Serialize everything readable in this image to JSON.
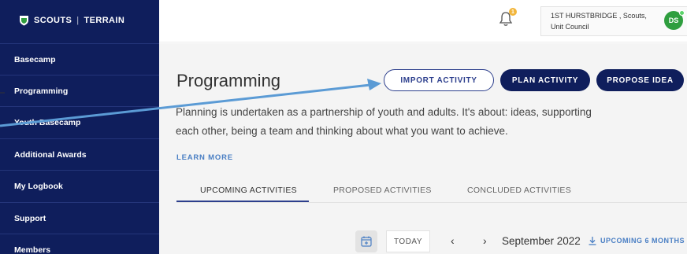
{
  "brand": {
    "name": "SCOUTS",
    "divider": "|",
    "product": "TERRAIN"
  },
  "sidebar": {
    "items": [
      {
        "label": "Basecamp"
      },
      {
        "label": "Programming"
      },
      {
        "label": "Youth Basecamp"
      },
      {
        "label": "Additional Awards"
      },
      {
        "label": "My Logbook"
      },
      {
        "label": "Support"
      },
      {
        "label": "Members"
      }
    ]
  },
  "header": {
    "notification_count": "1",
    "user_unit": "1ST HURSTBRIDGE , Scouts, Unit Council",
    "avatar_initials": "DS"
  },
  "main": {
    "title": "Programming",
    "buttons": {
      "import": "IMPORT ACTIVITY",
      "plan": "PLAN ACTIVITY",
      "propose": "PROPOSE IDEA"
    },
    "description": "Planning is undertaken as a partnership of youth and adults. It's about: ideas, supporting each other, being a team and thinking about what you want to achieve.",
    "learn_more": "LEARN MORE",
    "tabs": [
      {
        "label": "UPCOMING ACTIVITIES"
      },
      {
        "label": "PROPOSED ACTIVITIES"
      },
      {
        "label": "CONCLUDED ACTIVITIES"
      }
    ],
    "calendar": {
      "today": "TODAY",
      "month": "September 2022",
      "upcoming": "UPCOMING 6 MONTHS"
    }
  },
  "colors": {
    "sidebar_bg": "#0f1e5c",
    "primary": "#0f1e5c",
    "accent_link": "#4a7fc4",
    "annotation_arrow": "#5b9bd5",
    "avatar_bg": "#2f9e3f",
    "badge": "#f2b53a"
  }
}
